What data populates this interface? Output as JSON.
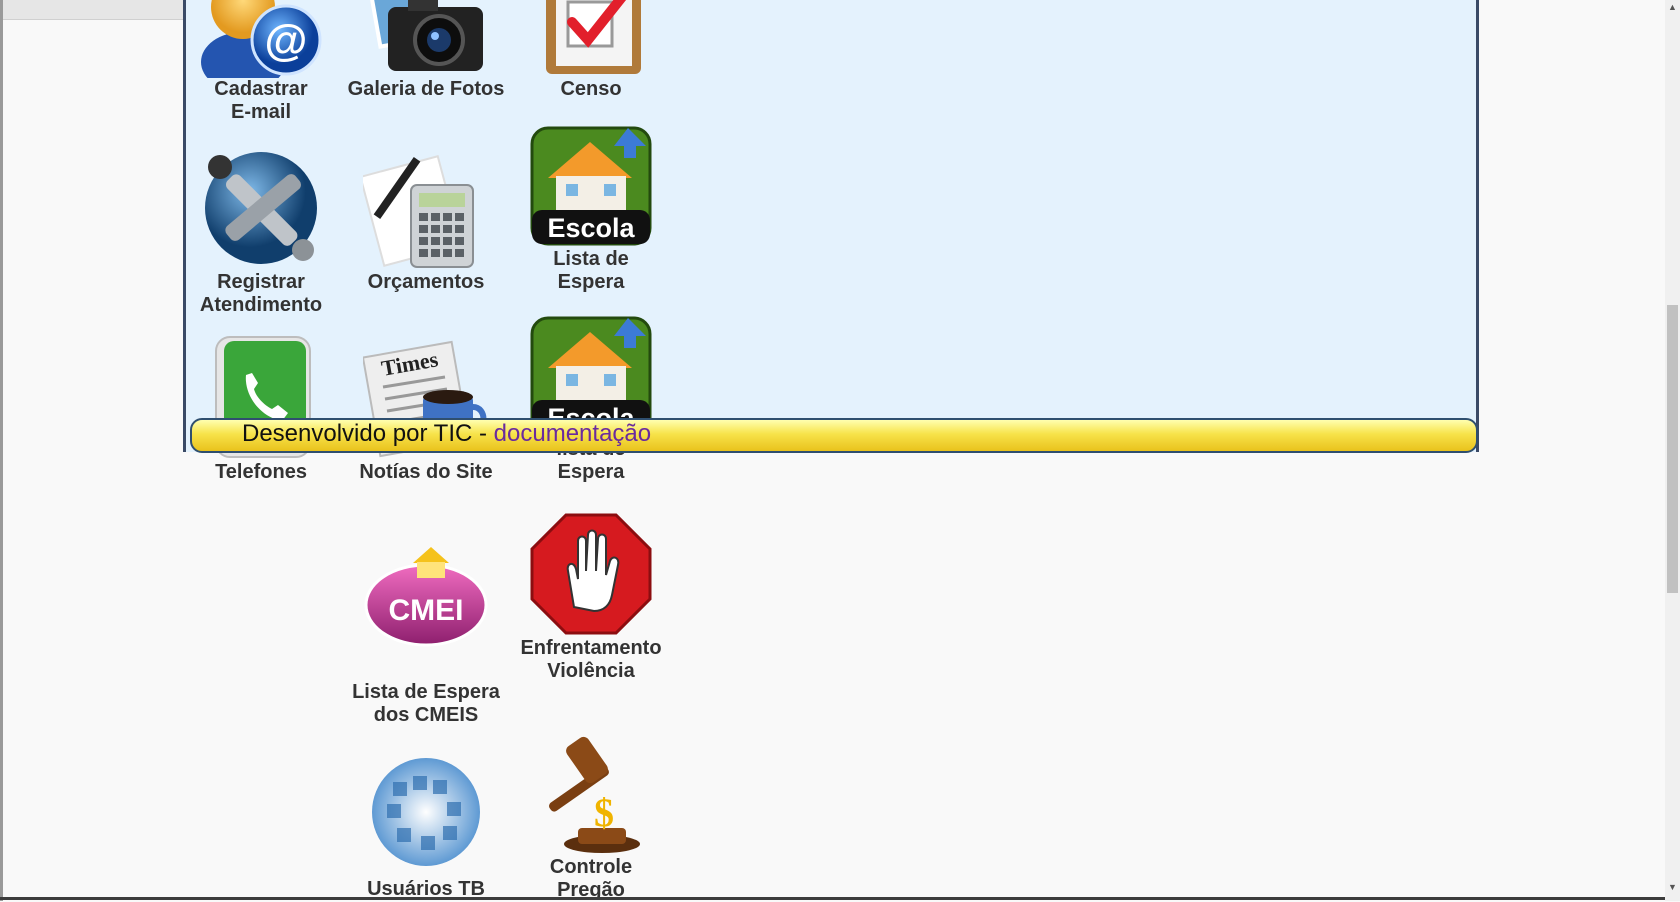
{
  "apps": [
    {
      "name": "Cadastrar E-mail",
      "lines": [
        "Cadastrar",
        "E-mail"
      ],
      "icon": "email-user-icon"
    },
    {
      "name": "Galeria de Fotos",
      "lines": [
        "Galeria de Fotos"
      ],
      "icon": "camera-icon"
    },
    {
      "name": "Censo",
      "lines": [
        "Censo"
      ],
      "icon": "checklist-icon"
    },
    {
      "name": "Registrar Atendimento",
      "lines": [
        "Registrar",
        "Atendimento"
      ],
      "icon": "globe-tools-icon"
    },
    {
      "name": "Orçamentos",
      "lines": [
        "Orçamentos"
      ],
      "icon": "calculator-icon"
    },
    {
      "name": "Lista de Espera",
      "lines": [
        "Lista de",
        "Espera"
      ],
      "icon": "escola-house-icon",
      "badge": "Escola"
    },
    {
      "name": "Telefones",
      "lines": [
        "Telefones"
      ],
      "icon": "phone-icon"
    },
    {
      "name": "Notías do Site",
      "lines": [
        "Notías do Site"
      ],
      "icon": "newspaper-coffee-icon",
      "paper": "Times"
    },
    {
      "name": "lista de Espera",
      "lines": [
        "lista de",
        "Espera"
      ],
      "icon": "escola-house-icon",
      "badge": "Escola"
    },
    {
      "name": "Lista de Espera dos CMEIS",
      "lines": [
        "Lista de Espera",
        "dos CMEIS"
      ],
      "icon": "cmei-icon",
      "badge": "CMEI"
    },
    {
      "name": "Enfrentamento Violência",
      "lines": [
        "Enfrentamento",
        "Violência"
      ],
      "icon": "stop-hand-icon"
    },
    {
      "name": "Usuários TB",
      "lines": [
        "Usuários TB"
      ],
      "icon": "network-globe-icon"
    },
    {
      "name": "Controle Pregão",
      "lines": [
        "Controle",
        "Pregão"
      ],
      "icon": "gavel-icon"
    }
  ],
  "footer": {
    "prefix": "Desenvolvido por TIC - ",
    "link": "documentação"
  }
}
